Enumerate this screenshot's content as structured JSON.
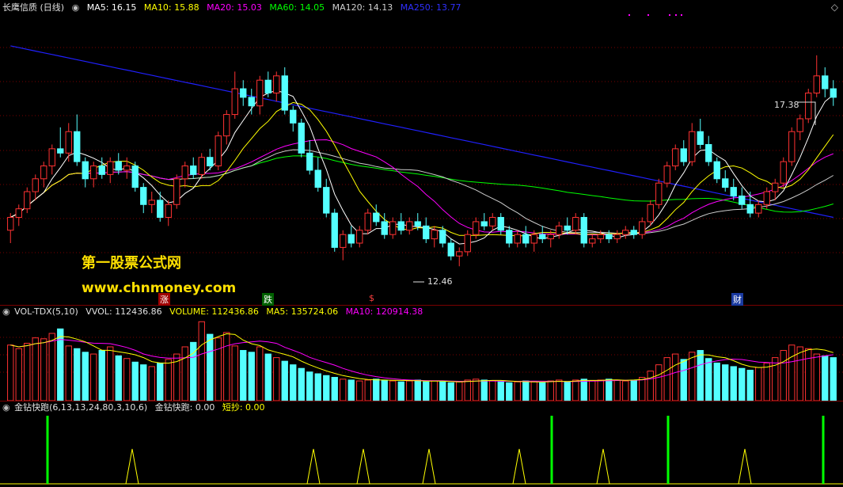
{
  "main_header": {
    "title": "长鹰信质 (日线)",
    "ma5": "MA5: 16.15",
    "ma10": "MA10: 15.88",
    "ma20": "MA20: 15.03",
    "ma60": "MA60: 14.05",
    "ma120": "MA120: 14.13",
    "ma250": "MA250: 13.77"
  },
  "vol_header": {
    "name": "VOL-TDX(5,10)",
    "vvol": "VVOL: 112436.86",
    "volume": "VOLUME: 112436.86",
    "ma5": "MA5: 135724.06",
    "ma10": "MA10: 120914.38"
  },
  "ind_header": {
    "name": "金钻快跑(6,13,13,24,80,3,10,6)",
    "value": "金钻快跑: 0.00",
    "short": "短抄: 0.00"
  },
  "watermark": {
    "line1": "第一股票公式网",
    "line2": "www.chnmoney.com"
  },
  "annotations": {
    "high": "17.38",
    "low": "12.46",
    "markers": [
      "涨",
      "跌",
      "$",
      "财"
    ]
  },
  "colors": {
    "up": "#ff3232",
    "down": "#54ffff",
    "ma5": "#ffffff",
    "ma10": "#ffff00",
    "ma20": "#ff00ff",
    "ma60": "#00ff00",
    "ma120": "#cccccc",
    "ma250": "#2020ff",
    "signal_green": "#00ff00",
    "signal_yellow": "#ffff00"
  },
  "chart_data": {
    "type": "candlestick",
    "price_range": [
      11.8,
      18.3
    ],
    "candles": [
      [
        13.3,
        13.7,
        13.0,
        13.6
      ],
      [
        13.6,
        13.9,
        13.4,
        13.8
      ],
      [
        13.8,
        14.3,
        13.7,
        14.2
      ],
      [
        14.2,
        14.6,
        14.0,
        14.5
      ],
      [
        14.5,
        14.9,
        14.3,
        14.8
      ],
      [
        14.8,
        15.3,
        14.6,
        15.2
      ],
      [
        15.2,
        15.7,
        15.0,
        15.1
      ],
      [
        15.1,
        15.8,
        14.9,
        15.6
      ],
      [
        15.6,
        16.0,
        14.8,
        14.9
      ],
      [
        14.9,
        15.0,
        14.3,
        14.5
      ],
      [
        14.5,
        14.9,
        14.3,
        14.8
      ],
      [
        14.8,
        15.0,
        14.5,
        14.6
      ],
      [
        14.6,
        15.0,
        14.4,
        14.9
      ],
      [
        14.9,
        15.1,
        14.6,
        14.7
      ],
      [
        14.7,
        15.0,
        14.5,
        14.8
      ],
      [
        14.8,
        14.9,
        14.2,
        14.3
      ],
      [
        14.3,
        14.4,
        13.7,
        13.9
      ],
      [
        13.9,
        14.2,
        13.7,
        14.0
      ],
      [
        14.0,
        14.2,
        13.5,
        13.6
      ],
      [
        13.6,
        14.0,
        13.4,
        13.9
      ],
      [
        13.9,
        14.6,
        13.8,
        14.5
      ],
      [
        14.5,
        14.9,
        14.3,
        14.8
      ],
      [
        14.8,
        15.0,
        14.5,
        14.6
      ],
      [
        14.6,
        15.1,
        14.5,
        15.0
      ],
      [
        15.0,
        15.2,
        14.7,
        14.8
      ],
      [
        14.8,
        15.6,
        14.7,
        15.5
      ],
      [
        15.5,
        16.1,
        15.3,
        16.0
      ],
      [
        16.0,
        17.0,
        15.9,
        16.6
      ],
      [
        16.6,
        16.8,
        16.2,
        16.4
      ],
      [
        16.4,
        16.6,
        16.0,
        16.2
      ],
      [
        16.2,
        16.9,
        16.0,
        16.8
      ],
      [
        16.8,
        17.0,
        16.4,
        16.5
      ],
      [
        16.5,
        17.0,
        16.3,
        16.9
      ],
      [
        16.9,
        17.1,
        16.0,
        16.1
      ],
      [
        16.1,
        16.2,
        15.6,
        15.8
      ],
      [
        15.8,
        15.9,
        15.0,
        15.1
      ],
      [
        15.1,
        15.4,
        14.6,
        14.7
      ],
      [
        14.7,
        15.0,
        14.2,
        14.3
      ],
      [
        14.3,
        14.5,
        13.6,
        13.7
      ],
      [
        13.7,
        13.8,
        12.8,
        12.9
      ],
      [
        12.9,
        13.3,
        12.6,
        13.2
      ],
      [
        13.2,
        13.4,
        12.9,
        13.0
      ],
      [
        13.0,
        13.4,
        12.9,
        13.3
      ],
      [
        13.3,
        13.8,
        13.2,
        13.7
      ],
      [
        13.7,
        13.9,
        13.4,
        13.5
      ],
      [
        13.5,
        13.7,
        13.1,
        13.2
      ],
      [
        13.2,
        13.6,
        13.1,
        13.5
      ],
      [
        13.5,
        13.7,
        13.2,
        13.3
      ],
      [
        13.3,
        13.6,
        13.2,
        13.5
      ],
      [
        13.5,
        13.7,
        13.3,
        13.4
      ],
      [
        13.4,
        13.6,
        13.0,
        13.1
      ],
      [
        13.1,
        13.4,
        12.9,
        13.3
      ],
      [
        13.3,
        13.4,
        12.9,
        13.0
      ],
      [
        13.0,
        13.1,
        12.6,
        12.7
      ],
      [
        12.7,
        12.9,
        12.46,
        12.8
      ],
      [
        12.8,
        13.3,
        12.7,
        13.2
      ],
      [
        13.2,
        13.6,
        13.1,
        13.5
      ],
      [
        13.5,
        13.7,
        13.3,
        13.4
      ],
      [
        13.4,
        13.7,
        13.3,
        13.6
      ],
      [
        13.6,
        13.7,
        13.2,
        13.3
      ],
      [
        13.3,
        13.4,
        12.9,
        13.0
      ],
      [
        13.0,
        13.3,
        12.9,
        13.2
      ],
      [
        13.2,
        13.4,
        12.9,
        13.0
      ],
      [
        13.0,
        13.3,
        12.8,
        13.2
      ],
      [
        13.2,
        13.4,
        13.0,
        13.1
      ],
      [
        13.1,
        13.3,
        12.9,
        13.2
      ],
      [
        13.2,
        13.5,
        13.1,
        13.4
      ],
      [
        13.4,
        13.6,
        13.2,
        13.3
      ],
      [
        13.3,
        13.7,
        13.2,
        13.6
      ],
      [
        13.6,
        13.7,
        12.9,
        13.0
      ],
      [
        13.0,
        13.2,
        12.9,
        13.1
      ],
      [
        13.1,
        13.3,
        13.0,
        13.2
      ],
      [
        13.2,
        13.3,
        13.0,
        13.1
      ],
      [
        13.1,
        13.3,
        13.0,
        13.2
      ],
      [
        13.2,
        13.4,
        13.1,
        13.3
      ],
      [
        13.3,
        13.4,
        13.1,
        13.2
      ],
      [
        13.2,
        13.6,
        13.1,
        13.5
      ],
      [
        13.5,
        14.0,
        13.4,
        13.9
      ],
      [
        13.9,
        14.5,
        13.8,
        14.4
      ],
      [
        14.4,
        14.9,
        14.3,
        14.8
      ],
      [
        14.8,
        15.3,
        14.7,
        15.2
      ],
      [
        15.2,
        15.4,
        14.8,
        14.9
      ],
      [
        14.9,
        15.8,
        14.8,
        15.6
      ],
      [
        15.6,
        15.9,
        15.2,
        15.3
      ],
      [
        15.3,
        15.5,
        14.8,
        14.9
      ],
      [
        14.9,
        15.0,
        14.4,
        14.5
      ],
      [
        14.5,
        14.7,
        14.2,
        14.3
      ],
      [
        14.3,
        14.5,
        14.0,
        14.1
      ],
      [
        14.1,
        14.3,
        13.8,
        13.9
      ],
      [
        13.9,
        14.2,
        13.6,
        13.7
      ],
      [
        13.7,
        14.0,
        13.6,
        13.9
      ],
      [
        13.9,
        14.3,
        13.8,
        14.2
      ],
      [
        14.2,
        14.5,
        14.0,
        14.4
      ],
      [
        14.4,
        15.0,
        14.3,
        14.9
      ],
      [
        14.9,
        15.7,
        14.8,
        15.6
      ],
      [
        15.6,
        16.0,
        15.4,
        15.9
      ],
      [
        15.9,
        16.6,
        15.8,
        16.5
      ],
      [
        16.5,
        17.38,
        16.4,
        16.9
      ],
      [
        16.9,
        17.1,
        16.4,
        16.6
      ],
      [
        16.6,
        16.8,
        16.2,
        16.4
      ]
    ],
    "volumes": [
      620,
      580,
      640,
      700,
      690,
      750,
      800,
      610,
      580,
      540,
      520,
      560,
      600,
      500,
      470,
      430,
      400,
      380,
      420,
      460,
      520,
      600,
      650,
      880,
      740,
      700,
      760,
      610,
      560,
      540,
      600,
      520,
      480,
      440,
      400,
      360,
      320,
      300,
      280,
      260,
      240,
      230,
      220,
      230,
      240,
      230,
      220,
      210,
      220,
      230,
      210,
      220,
      210,
      200,
      210,
      230,
      240,
      230,
      220,
      210,
      200,
      210,
      220,
      210,
      200,
      220,
      230,
      210,
      230,
      240,
      220,
      230,
      240,
      230,
      220,
      230,
      260,
      330,
      400,
      480,
      520,
      460,
      540,
      560,
      470,
      420,
      400,
      380,
      360,
      340,
      370,
      420,
      480,
      560,
      620,
      600,
      580,
      520,
      500,
      480
    ],
    "signals_green": [
      60,
      697,
      844,
      1040
    ],
    "signals_yellow": [
      167,
      396,
      459,
      542,
      656,
      762,
      941
    ]
  }
}
